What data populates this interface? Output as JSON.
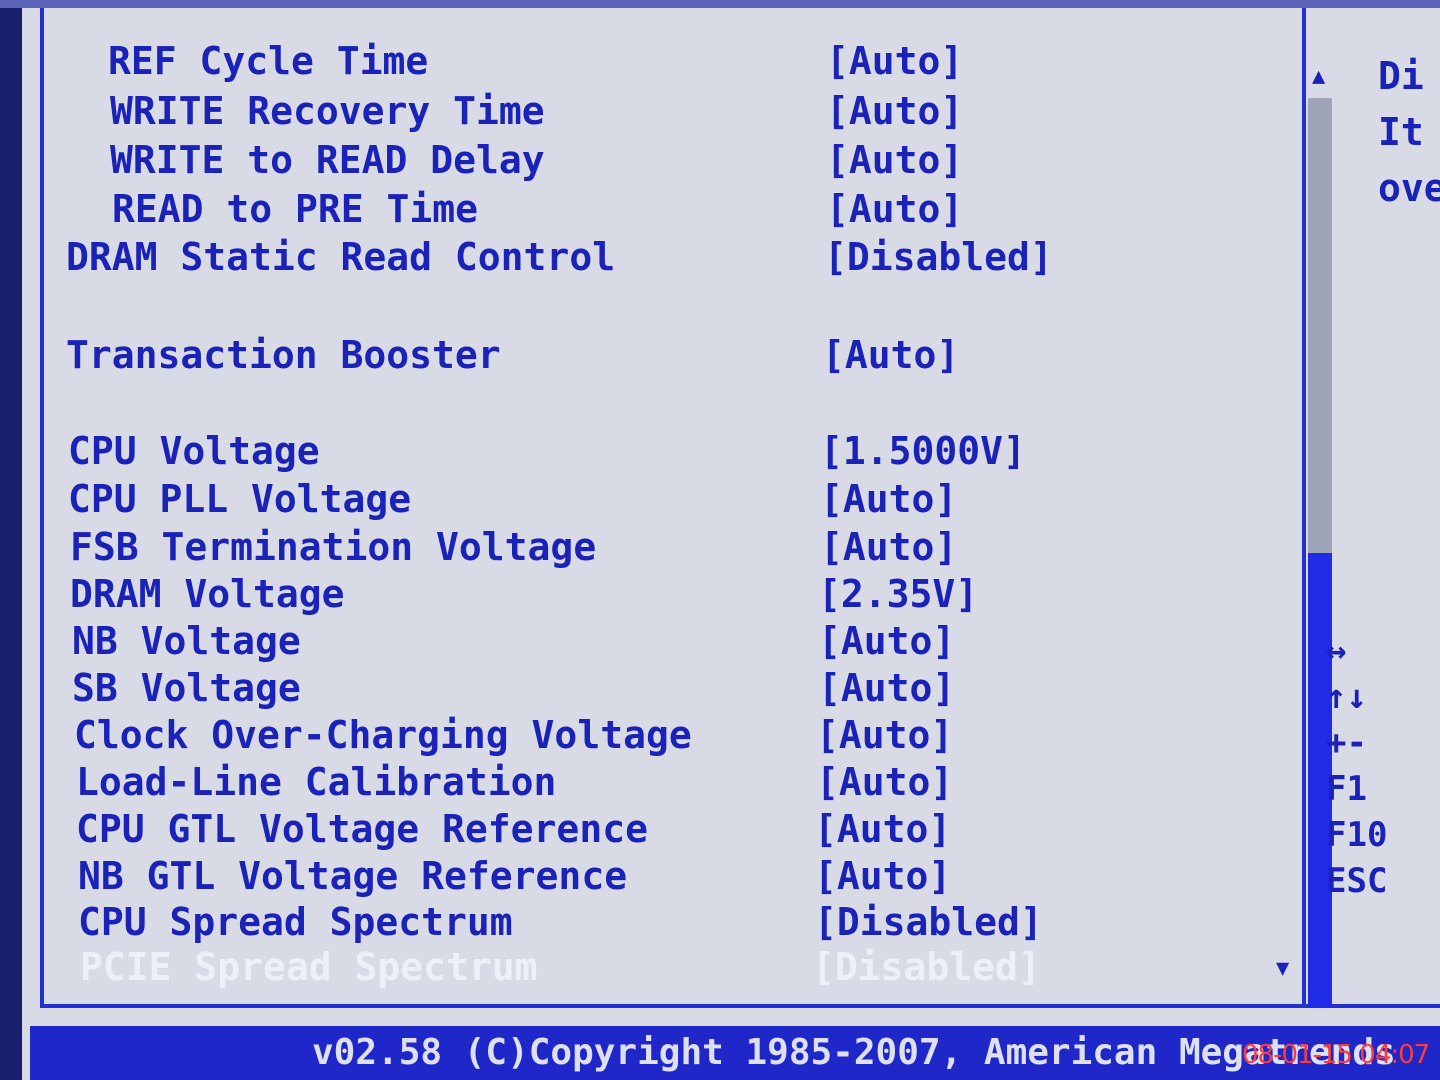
{
  "settings": [
    {
      "label": "REF Cycle Time",
      "value": "[Auto]"
    },
    {
      "label": "WRITE Recovery Time",
      "value": "[Auto]"
    },
    {
      "label": "WRITE to READ Delay",
      "value": "[Auto]"
    },
    {
      "label": "READ to PRE Time",
      "value": "[Auto]"
    },
    {
      "label": "DRAM Static Read Control",
      "value": "[Disabled]"
    },
    {
      "label": "Transaction Booster",
      "value": "[Auto]"
    },
    {
      "label": "CPU Voltage",
      "value": "[1.5000V]"
    },
    {
      "label": "CPU PLL Voltage",
      "value": "[Auto]"
    },
    {
      "label": "FSB Termination Voltage",
      "value": "[Auto]"
    },
    {
      "label": "DRAM Voltage",
      "value": "[2.35V]"
    },
    {
      "label": "NB Voltage",
      "value": "[Auto]"
    },
    {
      "label": "SB Voltage",
      "value": "[Auto]"
    },
    {
      "label": "Clock Over-Charging Voltage",
      "value": "[Auto]"
    },
    {
      "label": "Load-Line Calibration",
      "value": "[Auto]"
    },
    {
      "label": "CPU GTL Voltage Reference",
      "value": "[Auto]"
    },
    {
      "label": "NB GTL Voltage Reference",
      "value": "[Auto]"
    },
    {
      "label": "CPU Spread Spectrum",
      "value": "[Disabled]"
    },
    {
      "label": "PCIE Spread Spectrum",
      "value": "[Disabled]"
    }
  ],
  "scrollbar": {
    "position_fraction": 0.5,
    "up_icon": "triangle-up-icon",
    "down_icon": "triangle-down-icon"
  },
  "help": {
    "lines": [
      "Di",
      "It",
      "ove"
    ]
  },
  "keys": [
    "↔",
    "↑↓",
    "+-",
    "F1",
    "F10",
    "ESC"
  ],
  "footer": {
    "text": "v02.58 (C)Copyright 1985-2007, American Megatrends"
  },
  "camera_timestamp": "08-01-15 04:07",
  "colors": {
    "background": "#d8dbe6",
    "text": "#1b22b8",
    "frame": "#2230d0",
    "footer": "#2027c8",
    "selected_text": "#eef0f8",
    "timestamp": "#ff3a3a"
  }
}
